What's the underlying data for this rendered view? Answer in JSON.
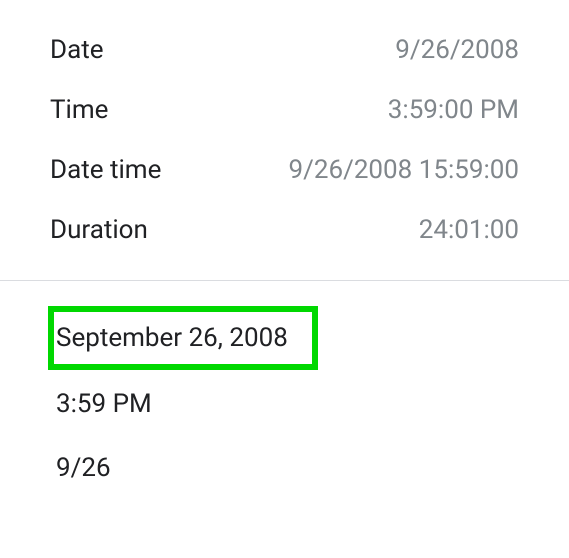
{
  "fields": {
    "date": {
      "label": "Date",
      "value": "9/26/2008"
    },
    "time": {
      "label": "Time",
      "value": "3:59:00 PM"
    },
    "datetime": {
      "label": "Date time",
      "value": "9/26/2008 15:59:00"
    },
    "duration": {
      "label": "Duration",
      "value": "24:01:00"
    }
  },
  "list": {
    "item1": "September 26, 2008",
    "item2": "3:59 PM",
    "item3": "9/26"
  },
  "highlight_color": "#00d800"
}
